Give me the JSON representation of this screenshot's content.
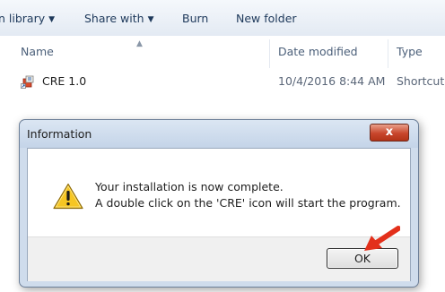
{
  "toolbar": {
    "items": [
      {
        "label": "n library",
        "has_menu": true
      },
      {
        "label": "Share with",
        "has_menu": true
      },
      {
        "label": "Burn",
        "has_menu": false
      },
      {
        "label": "New folder",
        "has_menu": false
      }
    ]
  },
  "columns": {
    "name": "Name",
    "date_modified": "Date modified",
    "type": "Type"
  },
  "files": [
    {
      "name": "CRE 1.0",
      "date_modified": "10/4/2016 8:44 AM",
      "type": "Shortcut",
      "icon": "shortcut-app-icon"
    }
  ],
  "dialog": {
    "title": "Information",
    "message_line1": "Your installation is now complete.",
    "message_line2": "A double click on the 'CRE' icon will start the program.",
    "icon": "warning-icon",
    "ok_label": "OK",
    "close_glyph": "x"
  },
  "annotation": {
    "icon": "red-arrow-icon",
    "color": "#e3301b"
  },
  "colors": {
    "accent_red": "#c8462c",
    "dialog_frame": "#cfdcec",
    "warning_yellow": "#f6c624"
  }
}
